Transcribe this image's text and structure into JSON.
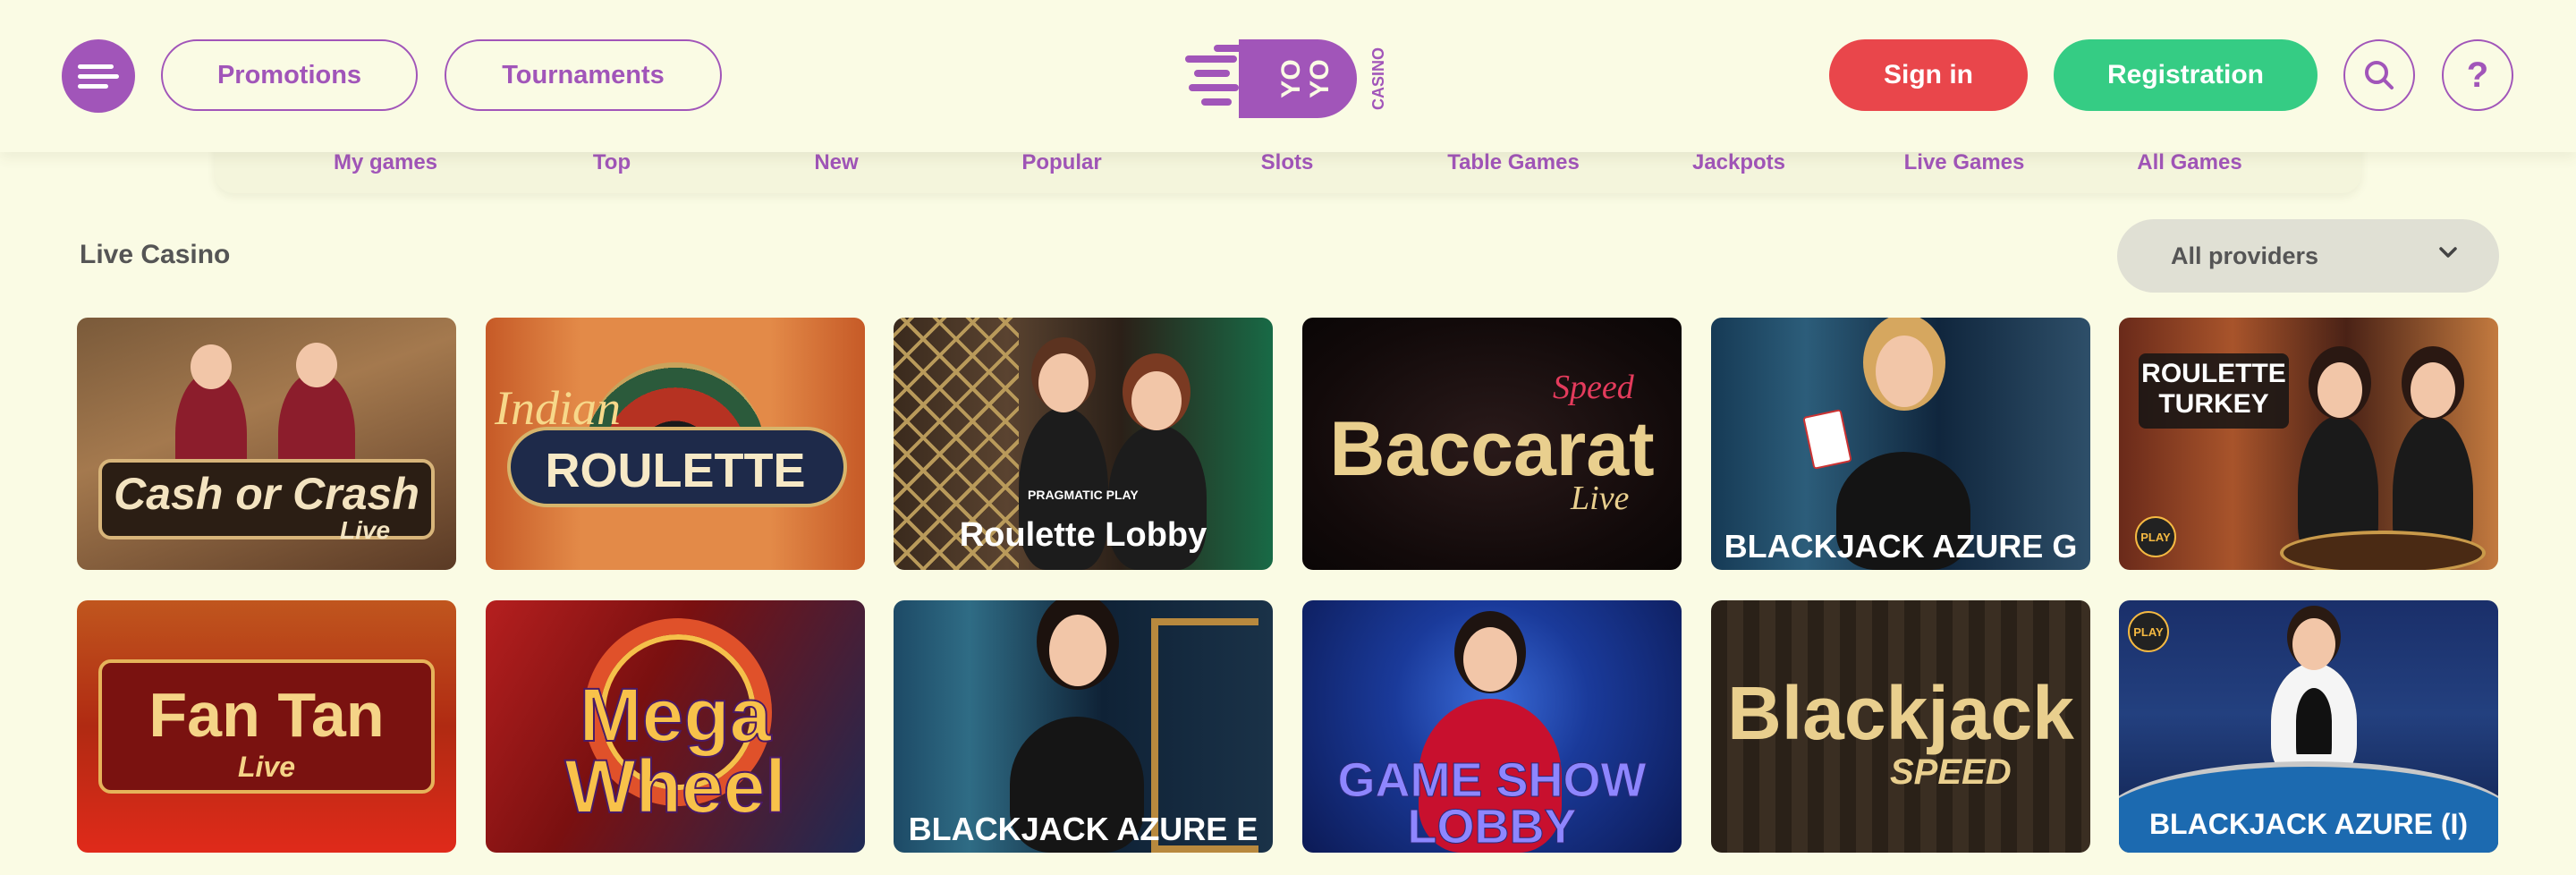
{
  "header": {
    "promotions_label": "Promotions",
    "tournaments_label": "Tournaments",
    "logo_text_1": "YO",
    "logo_text_2": "YO",
    "logo_text_3": "CASINO",
    "signin_label": "Sign in",
    "registration_label": "Registration",
    "help_symbol": "?"
  },
  "categories": [
    "My games",
    "Top",
    "New",
    "Popular",
    "Slots",
    "Table Games",
    "Jackpots",
    "Live Games",
    "All Games"
  ],
  "section": {
    "title": "Live Casino",
    "provider_select": "All providers"
  },
  "games": [
    {
      "title_line1": "Cash or Crash",
      "title_line2": "Live"
    },
    {
      "title_line1": "Indian",
      "title_line2": "ROULETTE"
    },
    {
      "title_line1": "Roulette Lobby",
      "brand": "PRAGMATIC PLAY"
    },
    {
      "title_line1": "Speed",
      "title_line2": "Baccarat",
      "title_line3": "Live"
    },
    {
      "title_line1": "BLACKJACK AZURE G"
    },
    {
      "title_line1": "ROULETTE",
      "title_line2": "TURKEY",
      "badge": "PLAY"
    },
    {
      "title_line1": "Fan Tan",
      "title_line2": "Live"
    },
    {
      "title_line1": "Mega",
      "title_line2": "Wheel"
    },
    {
      "title_line1": "BLACKJACK AZURE E"
    },
    {
      "title_line1": "GAME SHOW",
      "title_line2": "LOBBY"
    },
    {
      "title_line1": "Blackjack",
      "title_line2": "SPEED"
    },
    {
      "title_line1": "BLACKJACK AZURE (I)",
      "badge": "PLAY"
    }
  ],
  "colors": {
    "background": "#fafbe4",
    "accent_purple": "#a155b9",
    "signin_red": "#e9464b",
    "registration_green": "#35cc84"
  }
}
